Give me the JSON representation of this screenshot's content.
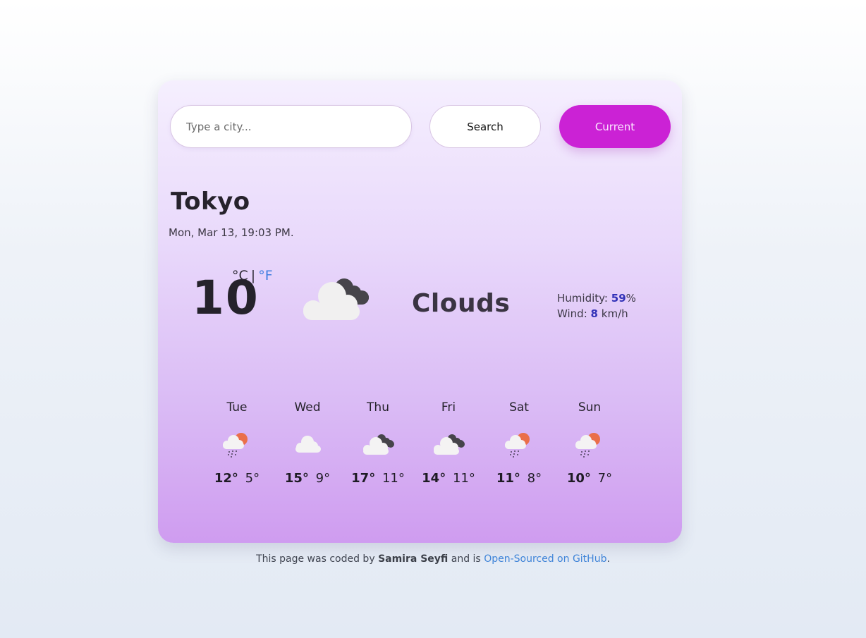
{
  "search": {
    "placeholder": "Type a city...",
    "value": "",
    "search_label": "Search",
    "current_label": "Current"
  },
  "weather": {
    "city": "Tokyo",
    "datetime": "Mon, Mar 13, 19:03 PM.",
    "temperature": "10",
    "unit_celsius": "°C",
    "unit_separator": "|",
    "unit_fahrenheit": "°F",
    "condition": "Clouds",
    "icon": "broken-clouds-icon",
    "humidity_label": "Humidity:",
    "humidity_value": "59",
    "humidity_unit": "%",
    "wind_label": "Wind:",
    "wind_value": "8",
    "wind_unit": "km/h"
  },
  "forecast": [
    {
      "day": "Tue",
      "icon": "rain-sun-icon",
      "max": "12°",
      "min": "5°"
    },
    {
      "day": "Wed",
      "icon": "cloud-icon",
      "max": "15°",
      "min": "9°"
    },
    {
      "day": "Thu",
      "icon": "broken-clouds-icon",
      "max": "17°",
      "min": "11°"
    },
    {
      "day": "Fri",
      "icon": "broken-clouds-icon",
      "max": "14°",
      "min": "11°"
    },
    {
      "day": "Sat",
      "icon": "rain-sun-icon",
      "max": "11°",
      "min": "8°"
    },
    {
      "day": "Sun",
      "icon": "rain-sun-icon",
      "max": "10°",
      "min": "7°"
    }
  ],
  "footer": {
    "prefix": "This page was coded by",
    "author": "Samira Seyfi",
    "middle": "and is",
    "link_text": "Open-Sourced on GitHub",
    "suffix": "."
  },
  "colors": {
    "accent": "#cb22d5",
    "link": "#3f84d8",
    "value_highlight": "#3232b8"
  }
}
